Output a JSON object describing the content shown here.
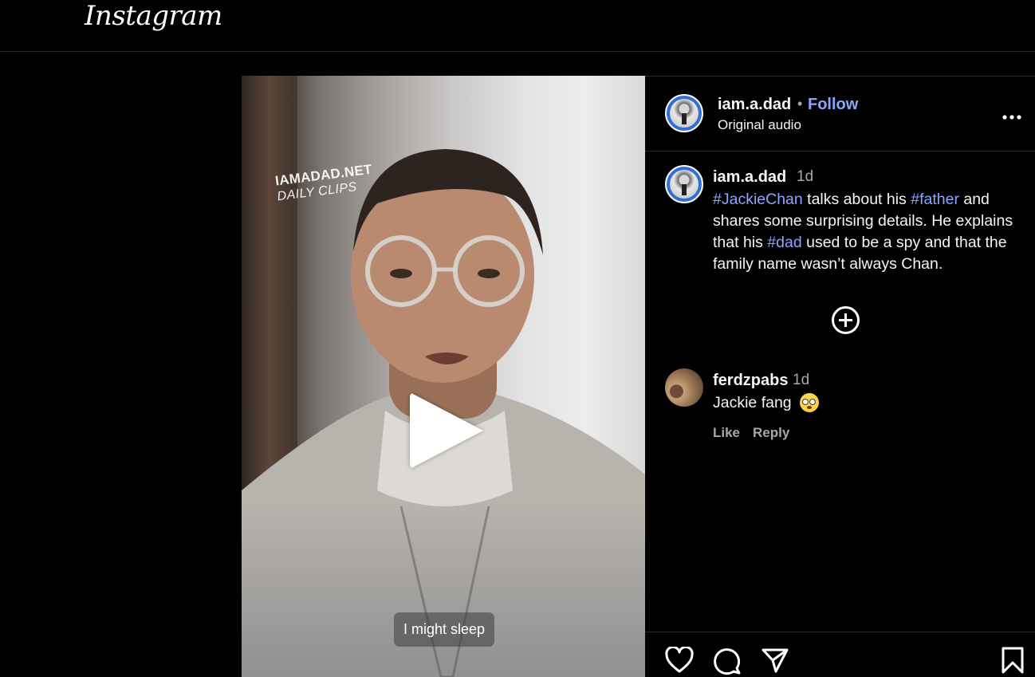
{
  "header": {
    "logo": "Instagram"
  },
  "video": {
    "watermark_line1": "IAMADAD.NET",
    "watermark_line2": "DAILY CLIPS",
    "subtitle": "I might sleep"
  },
  "post": {
    "username": "iam.a.dad",
    "separator": "•",
    "follow_label": "Follow",
    "audio_label": "Original audio"
  },
  "caption": {
    "username": "iam.a.dad",
    "time": "1d",
    "parts": [
      {
        "text": "#JackieChan",
        "hashtag": true
      },
      {
        "text": " talks about his ",
        "hashtag": false
      },
      {
        "text": "#father",
        "hashtag": true
      },
      {
        "text": " and shares some surprising details. He explains that his ",
        "hashtag": false
      },
      {
        "text": "#dad",
        "hashtag": true
      },
      {
        "text": " used to be a spy and that the family name wasn’t always Chan.",
        "hashtag": false
      }
    ]
  },
  "comments": [
    {
      "username": "ferdzpabs",
      "time": "1d",
      "text": "Jackie fang",
      "emoji": "flushed-face",
      "like_label": "Like",
      "reply_label": "Reply"
    }
  ],
  "icons": {
    "more": "more-horizontal-icon",
    "add": "add-circle-icon",
    "like": "heart-icon",
    "comment": "comment-icon",
    "share": "share-icon",
    "save": "bookmark-icon"
  },
  "colors": {
    "background": "#000000",
    "link": "#8aa6ff",
    "muted": "#a8a8a8",
    "divider": "#262626"
  }
}
